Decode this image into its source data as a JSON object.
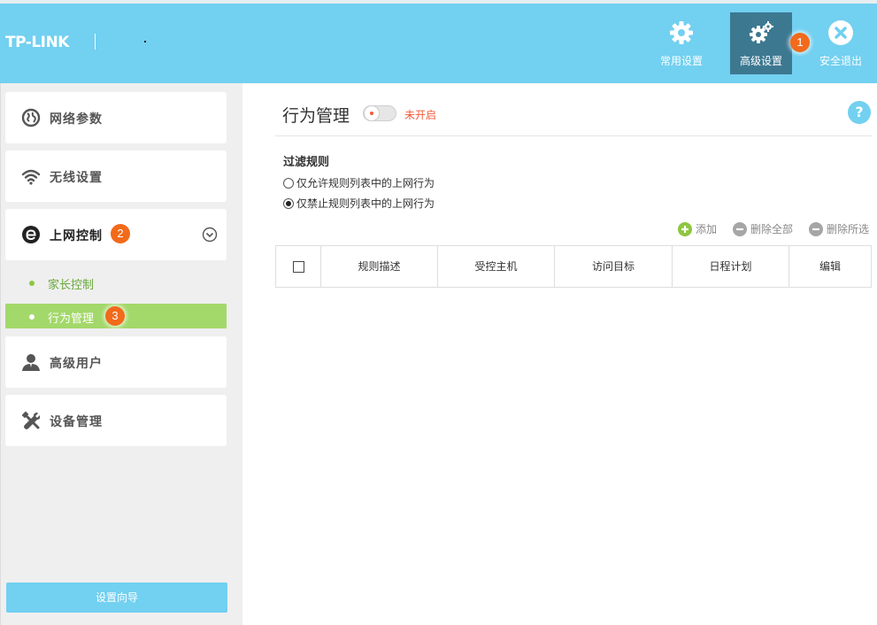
{
  "header": {
    "logo": "TP-LINK",
    "nav": [
      {
        "label": "常用设置",
        "icon": "gear-icon"
      },
      {
        "label": "高级设置",
        "icon": "gears-icon",
        "active": true
      },
      {
        "label": "安全退出",
        "icon": "close-circle-icon"
      }
    ],
    "badge": "1"
  },
  "sidebar": {
    "menu": [
      {
        "label": "网络参数",
        "icon": "globe-icon"
      },
      {
        "label": "无线设置",
        "icon": "wifi-icon"
      },
      {
        "label": "上网控制",
        "icon": "internet-e-icon",
        "expanded": true,
        "badge": "2"
      },
      {
        "label": "高级用户",
        "icon": "user-icon"
      },
      {
        "label": "设备管理",
        "icon": "tools-icon"
      }
    ],
    "submenu": [
      {
        "label": "家长控制"
      },
      {
        "label": "行为管理",
        "selected": true,
        "badge": "3"
      }
    ],
    "wizard_label": "设置向导"
  },
  "main": {
    "title": "行为管理",
    "toggle_status": "未开启",
    "help": "?",
    "filter_title": "过滤规则",
    "radios": [
      {
        "label": "仅允许规则列表中的上网行为",
        "checked": false
      },
      {
        "label": "仅禁止规则列表中的上网行为",
        "checked": true
      }
    ],
    "actions": {
      "add": "添加",
      "delete_all": "删除全部",
      "delete_selected": "删除所选"
    },
    "table": {
      "columns": [
        "规则描述",
        "受控主机",
        "访问目标",
        "日程计划",
        "编辑"
      ]
    }
  },
  "colors": {
    "header_bg": "#72d0f0",
    "active_nav": "#3d7891",
    "selected_sub": "#a3d86a",
    "badge": "#f26a1b",
    "off_status": "#f15a3a"
  }
}
